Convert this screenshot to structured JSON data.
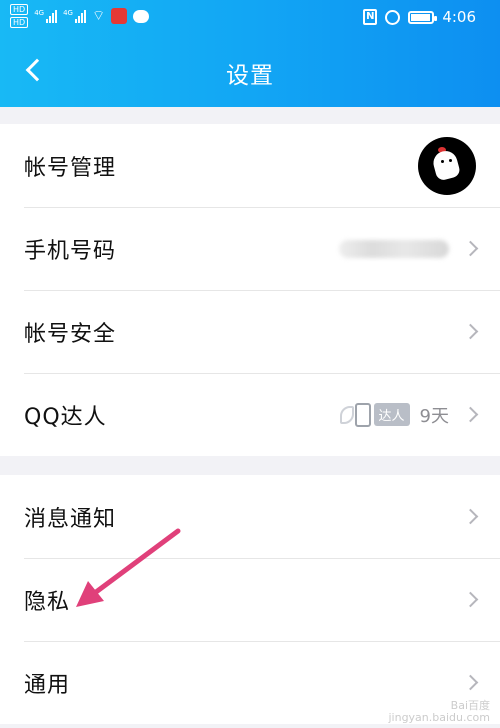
{
  "status_bar": {
    "hd1": "HD",
    "hd2": "HD",
    "net1": "4G",
    "net2": "4G",
    "nfc": "N",
    "battery_level": 0.85,
    "time": "4:06"
  },
  "header": {
    "title": "设置",
    "back_icon": "chevron-left-icon"
  },
  "group1": [
    {
      "label": "帐号管理"
    },
    {
      "label": "手机号码"
    },
    {
      "label": "帐号安全"
    },
    {
      "label": "QQ达人",
      "badge": "达人",
      "days": "9天"
    }
  ],
  "group2": [
    {
      "label": "消息通知"
    },
    {
      "label": "隐私"
    },
    {
      "label": "通用"
    }
  ],
  "annotation": {
    "color": "#e0407a"
  },
  "watermark": {
    "line1": "Bai百度",
    "line2": "jingyan.baidu.com"
  }
}
